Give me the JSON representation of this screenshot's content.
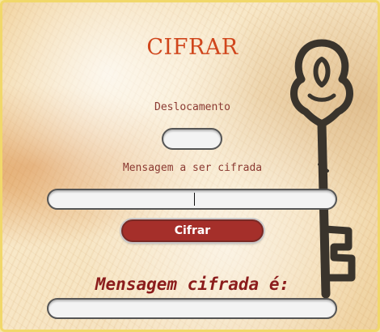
{
  "header": {
    "title": "CIFRAR"
  },
  "form": {
    "shift_label": "Deslocamento",
    "shift_value": "",
    "message_label": "Mensagem a ser cifrada",
    "message_value": "",
    "submit_label": "Cifrar"
  },
  "result": {
    "label": "Mensagem cifrada é:",
    "value": ""
  },
  "colors": {
    "title": "#d0461c",
    "label": "#8b3a32",
    "button": "#a52f2a",
    "result_label": "#8b1c1c",
    "border_gold": "#f1d86a"
  },
  "icons": {
    "decoration": "antique-key-icon"
  }
}
